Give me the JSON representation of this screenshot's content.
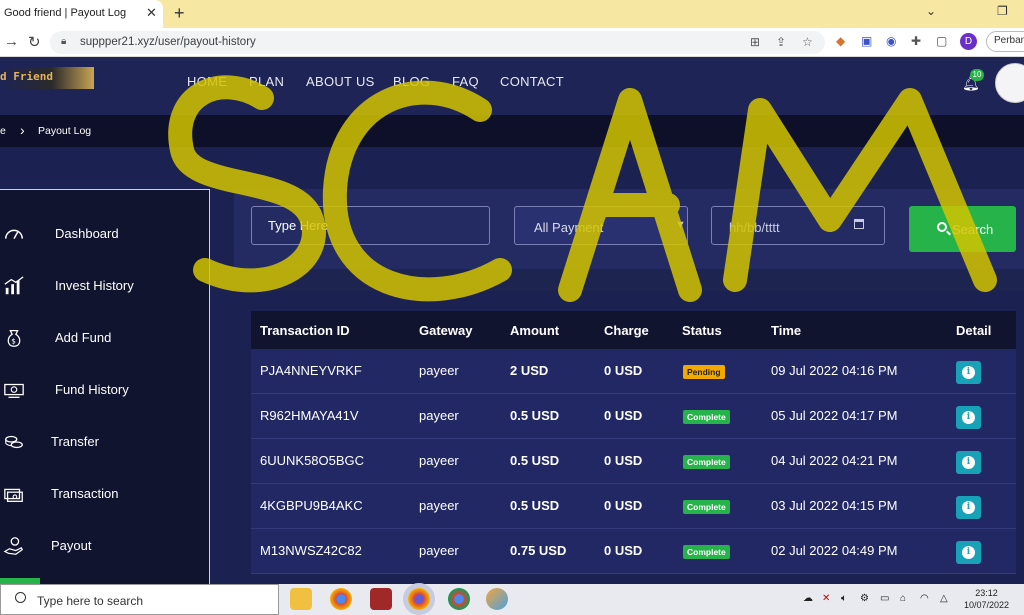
{
  "browser": {
    "tab_title": "Good friend | Payout Log",
    "tab_close": "✕",
    "new_tab": "+",
    "url": "suppper21.xyz/user/payout-history",
    "profile_initial": "D",
    "profile_label": "Perban"
  },
  "site": {
    "logo_text": "d Friend",
    "menu": [
      "HOME",
      "PLAN",
      "ABOUT US",
      "BLOG",
      "FAQ",
      "CONTACT"
    ],
    "notification_count": "10",
    "breadcrumb": {
      "home": "e",
      "separator": "›",
      "current": "Payout Log"
    }
  },
  "sidebar": {
    "items": [
      {
        "label": "Dashboard",
        "icon": "gauge-icon"
      },
      {
        "label": "Invest History",
        "icon": "chart-icon"
      },
      {
        "label": "Add Fund",
        "icon": "money-bag-icon"
      },
      {
        "label": "Fund History",
        "icon": "banknote-icon"
      },
      {
        "label": "Transfer",
        "icon": "coins-icon"
      },
      {
        "label": "Transaction",
        "icon": "cash-stack-icon"
      },
      {
        "label": "Payout",
        "icon": "hand-money-icon"
      }
    ]
  },
  "filters": {
    "search_placeholder": "Type Here",
    "gateway_selected": "All Payment",
    "date_placeholder": "hh/bb/tttt",
    "search_button": "Search"
  },
  "table": {
    "headers": [
      "Transaction ID",
      "Gateway",
      "Amount",
      "Charge",
      "Status",
      "Time",
      "Detail"
    ],
    "rows": [
      {
        "id": "PJA4NNEYVRKF",
        "gateway": "payeer",
        "amount": "2 USD",
        "charge": "0 USD",
        "status": "Pending",
        "time": "09 Jul 2022 04:16 PM"
      },
      {
        "id": "R962HMAYA41V",
        "gateway": "payeer",
        "amount": "0.5 USD",
        "charge": "0 USD",
        "status": "Complete",
        "time": "05 Jul 2022 04:17 PM"
      },
      {
        "id": "6UUNK58O5BGC",
        "gateway": "payeer",
        "amount": "0.5 USD",
        "charge": "0 USD",
        "status": "Complete",
        "time": "04 Jul 2022 04:21 PM"
      },
      {
        "id": "4KGBPU9B4AKC",
        "gateway": "payeer",
        "amount": "0.5 USD",
        "charge": "0 USD",
        "status": "Complete",
        "time": "03 Jul 2022 04:15 PM"
      },
      {
        "id": "M13NWSZ42C82",
        "gateway": "payeer",
        "amount": "0.75 USD",
        "charge": "0 USD",
        "status": "Complete",
        "time": "02 Jul 2022 04:49 PM"
      }
    ]
  },
  "taskbar": {
    "search_placeholder": "Type here to search",
    "time": "23:12",
    "date": "10/07/2022"
  },
  "overlay": {
    "text": "SCAM",
    "color": "#d4c400"
  }
}
